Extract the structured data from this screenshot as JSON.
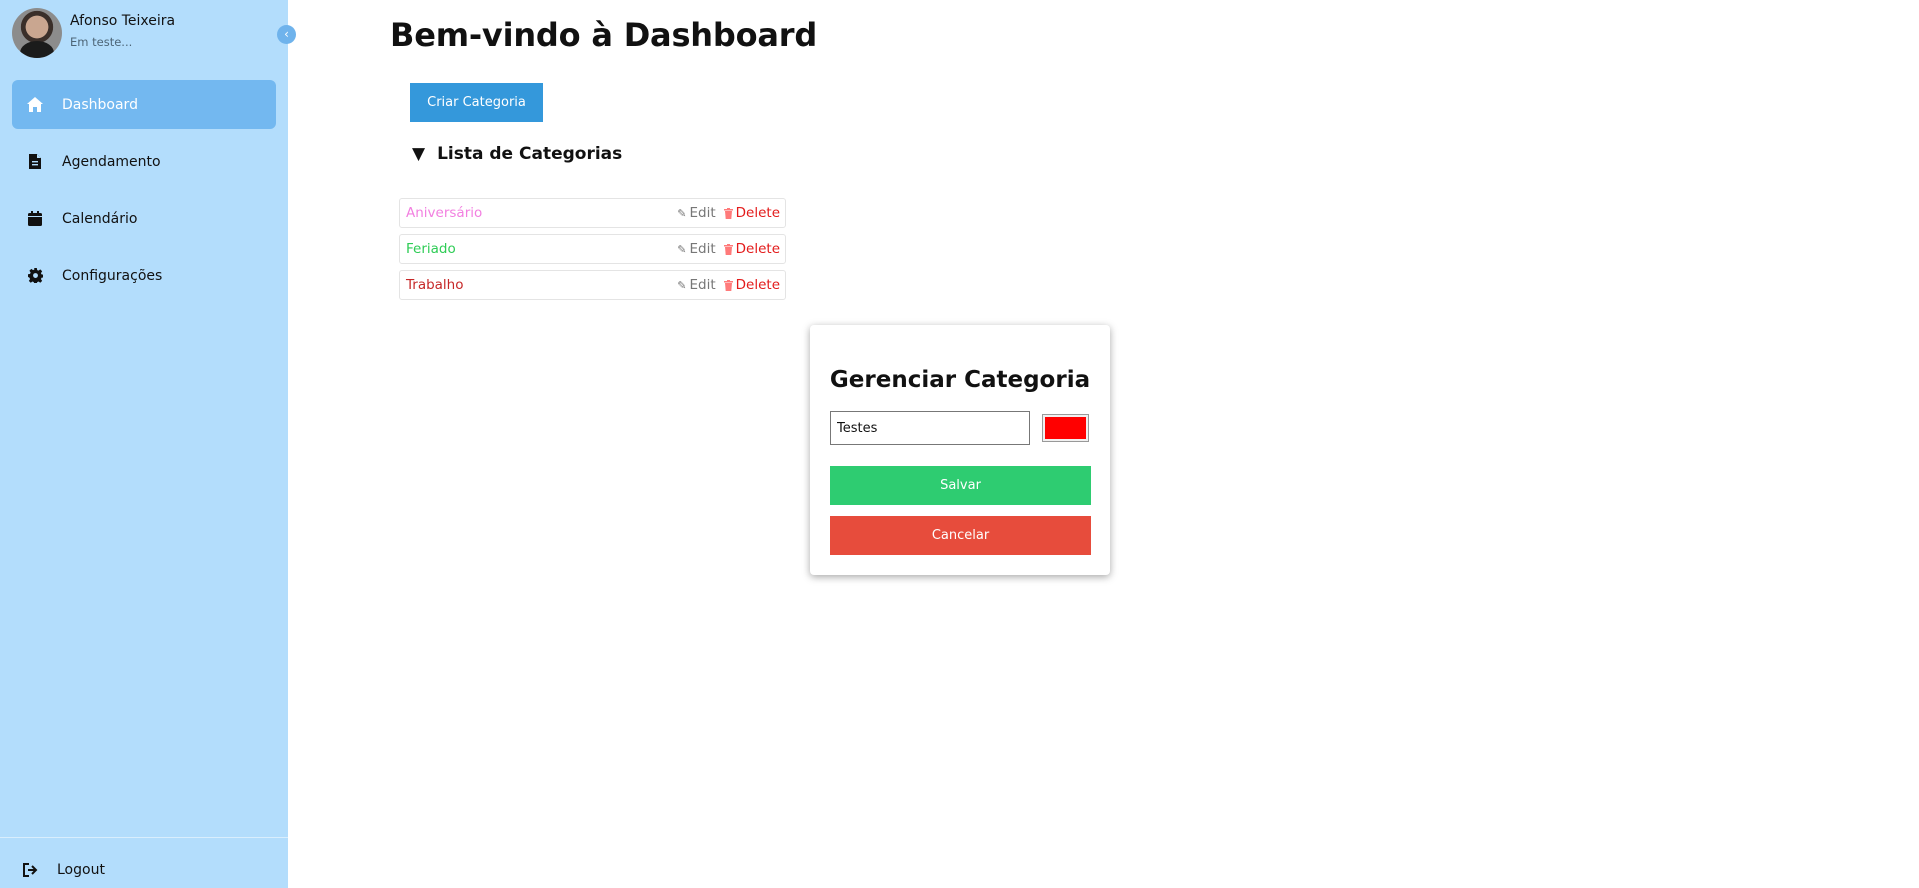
{
  "sidebar": {
    "profile": {
      "name": "Afonso Teixeira",
      "status": "Em teste..."
    },
    "collapse_icon": "chevron-left-icon",
    "items": [
      {
        "label": "Dashboard",
        "icon": "home-icon",
        "active": true
      },
      {
        "label": "Agendamento",
        "icon": "document-icon",
        "active": false
      },
      {
        "label": "Calendário",
        "icon": "calendar-icon",
        "active": false
      },
      {
        "label": "Configurações",
        "icon": "gear-icon",
        "active": false
      }
    ],
    "logout": {
      "label": "Logout",
      "icon": "logout-icon"
    }
  },
  "main": {
    "title": "Bem-vindo à Dashboard",
    "create_button": "Criar Categoria",
    "list_toggle": {
      "arrow": "▼",
      "label": "Lista de Categorias"
    },
    "edit_label": "Edit",
    "delete_label": "Delete",
    "categories": [
      {
        "name": "Aniversário",
        "color": "#f27fe0"
      },
      {
        "name": "Feriado",
        "color": "#2ecc55"
      },
      {
        "name": "Trabalho",
        "color": "#c62828"
      }
    ]
  },
  "modal": {
    "title": "Gerenciar Categoria",
    "name_value": "Testes",
    "color_value": "#ff0000",
    "save_label": "Salvar",
    "cancel_label": "Cancelar"
  },
  "colors": {
    "sidebar_bg": "#b3ddfc",
    "active_item": "#73b8f0",
    "primary": "#3498db",
    "save": "#2ecc71",
    "cancel": "#e74c3c",
    "delete": "#e31b1b"
  }
}
